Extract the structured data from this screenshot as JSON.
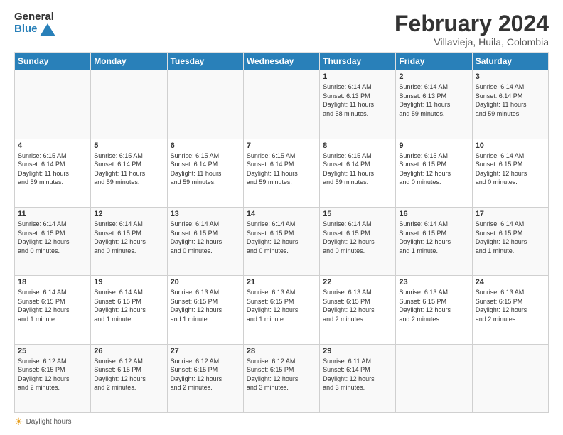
{
  "logo": {
    "general": "General",
    "blue": "Blue"
  },
  "title": "February 2024",
  "subtitle": "Villavieja, Huila, Colombia",
  "days_header": [
    "Sunday",
    "Monday",
    "Tuesday",
    "Wednesday",
    "Thursday",
    "Friday",
    "Saturday"
  ],
  "weeks": [
    [
      {
        "day": "",
        "info": ""
      },
      {
        "day": "",
        "info": ""
      },
      {
        "day": "",
        "info": ""
      },
      {
        "day": "",
        "info": ""
      },
      {
        "day": "1",
        "info": "Sunrise: 6:14 AM\nSunset: 6:13 PM\nDaylight: 11 hours\nand 58 minutes."
      },
      {
        "day": "2",
        "info": "Sunrise: 6:14 AM\nSunset: 6:13 PM\nDaylight: 11 hours\nand 59 minutes."
      },
      {
        "day": "3",
        "info": "Sunrise: 6:14 AM\nSunset: 6:14 PM\nDaylight: 11 hours\nand 59 minutes."
      }
    ],
    [
      {
        "day": "4",
        "info": "Sunrise: 6:15 AM\nSunset: 6:14 PM\nDaylight: 11 hours\nand 59 minutes."
      },
      {
        "day": "5",
        "info": "Sunrise: 6:15 AM\nSunset: 6:14 PM\nDaylight: 11 hours\nand 59 minutes."
      },
      {
        "day": "6",
        "info": "Sunrise: 6:15 AM\nSunset: 6:14 PM\nDaylight: 11 hours\nand 59 minutes."
      },
      {
        "day": "7",
        "info": "Sunrise: 6:15 AM\nSunset: 6:14 PM\nDaylight: 11 hours\nand 59 minutes."
      },
      {
        "day": "8",
        "info": "Sunrise: 6:15 AM\nSunset: 6:14 PM\nDaylight: 11 hours\nand 59 minutes."
      },
      {
        "day": "9",
        "info": "Sunrise: 6:15 AM\nSunset: 6:15 PM\nDaylight: 12 hours\nand 0 minutes."
      },
      {
        "day": "10",
        "info": "Sunrise: 6:14 AM\nSunset: 6:15 PM\nDaylight: 12 hours\nand 0 minutes."
      }
    ],
    [
      {
        "day": "11",
        "info": "Sunrise: 6:14 AM\nSunset: 6:15 PM\nDaylight: 12 hours\nand 0 minutes."
      },
      {
        "day": "12",
        "info": "Sunrise: 6:14 AM\nSunset: 6:15 PM\nDaylight: 12 hours\nand 0 minutes."
      },
      {
        "day": "13",
        "info": "Sunrise: 6:14 AM\nSunset: 6:15 PM\nDaylight: 12 hours\nand 0 minutes."
      },
      {
        "day": "14",
        "info": "Sunrise: 6:14 AM\nSunset: 6:15 PM\nDaylight: 12 hours\nand 0 minutes."
      },
      {
        "day": "15",
        "info": "Sunrise: 6:14 AM\nSunset: 6:15 PM\nDaylight: 12 hours\nand 0 minutes."
      },
      {
        "day": "16",
        "info": "Sunrise: 6:14 AM\nSunset: 6:15 PM\nDaylight: 12 hours\nand 1 minute."
      },
      {
        "day": "17",
        "info": "Sunrise: 6:14 AM\nSunset: 6:15 PM\nDaylight: 12 hours\nand 1 minute."
      }
    ],
    [
      {
        "day": "18",
        "info": "Sunrise: 6:14 AM\nSunset: 6:15 PM\nDaylight: 12 hours\nand 1 minute."
      },
      {
        "day": "19",
        "info": "Sunrise: 6:14 AM\nSunset: 6:15 PM\nDaylight: 12 hours\nand 1 minute."
      },
      {
        "day": "20",
        "info": "Sunrise: 6:13 AM\nSunset: 6:15 PM\nDaylight: 12 hours\nand 1 minute."
      },
      {
        "day": "21",
        "info": "Sunrise: 6:13 AM\nSunset: 6:15 PM\nDaylight: 12 hours\nand 1 minute."
      },
      {
        "day": "22",
        "info": "Sunrise: 6:13 AM\nSunset: 6:15 PM\nDaylight: 12 hours\nand 2 minutes."
      },
      {
        "day": "23",
        "info": "Sunrise: 6:13 AM\nSunset: 6:15 PM\nDaylight: 12 hours\nand 2 minutes."
      },
      {
        "day": "24",
        "info": "Sunrise: 6:13 AM\nSunset: 6:15 PM\nDaylight: 12 hours\nand 2 minutes."
      }
    ],
    [
      {
        "day": "25",
        "info": "Sunrise: 6:12 AM\nSunset: 6:15 PM\nDaylight: 12 hours\nand 2 minutes."
      },
      {
        "day": "26",
        "info": "Sunrise: 6:12 AM\nSunset: 6:15 PM\nDaylight: 12 hours\nand 2 minutes."
      },
      {
        "day": "27",
        "info": "Sunrise: 6:12 AM\nSunset: 6:15 PM\nDaylight: 12 hours\nand 2 minutes."
      },
      {
        "day": "28",
        "info": "Sunrise: 6:12 AM\nSunset: 6:15 PM\nDaylight: 12 hours\nand 3 minutes."
      },
      {
        "day": "29",
        "info": "Sunrise: 6:11 AM\nSunset: 6:14 PM\nDaylight: 12 hours\nand 3 minutes."
      },
      {
        "day": "",
        "info": ""
      },
      {
        "day": "",
        "info": ""
      }
    ]
  ],
  "footer": {
    "sun_icon": "☀",
    "daylight_label": "Daylight hours"
  }
}
